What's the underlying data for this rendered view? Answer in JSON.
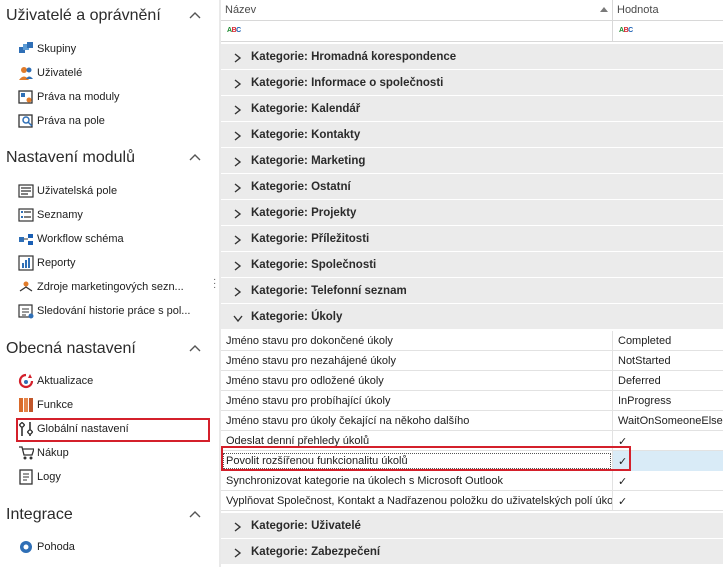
{
  "nav": {
    "sections": [
      {
        "title": "Uživatelé a oprávnění",
        "items": [
          {
            "label": "Skupiny",
            "icon": "groups-icon"
          },
          {
            "label": "Uživatelé",
            "icon": "users-icon"
          },
          {
            "label": "Práva na moduly",
            "icon": "module-rights-icon"
          },
          {
            "label": "Práva na pole",
            "icon": "field-rights-icon"
          }
        ]
      },
      {
        "title": "Nastavení modulů",
        "items": [
          {
            "label": "Uživatelská pole",
            "icon": "custom-fields-icon"
          },
          {
            "label": "Seznamy",
            "icon": "lists-icon"
          },
          {
            "label": "Workflow schéma",
            "icon": "workflow-icon"
          },
          {
            "label": "Reporty",
            "icon": "reports-icon"
          },
          {
            "label": "Zdroje marketingových sezn...",
            "icon": "marketing-sources-icon"
          },
          {
            "label": "Sledování historie práce s pol...",
            "icon": "history-tracking-icon"
          }
        ]
      },
      {
        "title": "Obecná nastavení",
        "items": [
          {
            "label": "Aktualizace",
            "icon": "update-icon"
          },
          {
            "label": "Funkce",
            "icon": "features-icon"
          },
          {
            "label": "Globální nastavení",
            "icon": "global-settings-icon",
            "selected": true
          },
          {
            "label": "Nákup",
            "icon": "cart-icon"
          },
          {
            "label": "Logy",
            "icon": "logs-icon"
          }
        ]
      },
      {
        "title": "Integrace",
        "items": [
          {
            "label": "Pohoda",
            "icon": "pohoda-icon"
          }
        ]
      }
    ]
  },
  "grid": {
    "columns": {
      "name": "Název",
      "value": "Hodnota"
    },
    "filter_icon": "abc-filter-icon",
    "colors": {
      "group_bg": "#ebebeb",
      "focus_bg": "#d9ebf7",
      "highlight": "#d4202b"
    },
    "groups_before": [
      "Kategorie: Hromadná korespondence",
      "Kategorie: Informace o společnosti",
      "Kategorie: Kalendář",
      "Kategorie: Kontakty",
      "Kategorie: Marketing",
      "Kategorie: Ostatní",
      "Kategorie: Projekty",
      "Kategorie: Příležitosti",
      "Kategorie: Společnosti",
      "Kategorie: Telefonní seznam"
    ],
    "expanded_group": "Kategorie: Úkoly",
    "rows": [
      {
        "name": "Jméno stavu pro dokončené úkoly",
        "value": "Completed"
      },
      {
        "name": "Jméno stavu pro nezahájené úkoly",
        "value": "NotStarted"
      },
      {
        "name": "Jméno stavu pro odložené úkoly",
        "value": "Deferred"
      },
      {
        "name": "Jméno stavu pro probíhající úkoly",
        "value": "InProgress"
      },
      {
        "name": "Jméno stavu pro úkoly čekající na někoho dalšího",
        "value": "WaitOnSomeoneElse"
      },
      {
        "name": "Odeslat denní přehledy úkolů",
        "value": "✓"
      },
      {
        "name": "Povolit rozšířenou funkcionalitu úkolů",
        "value": "✓",
        "focused": true
      },
      {
        "name": "Synchronizovat kategorie na úkolech s Microsoft Outlook",
        "value": "✓"
      },
      {
        "name": "Vyplňovat Společnost, Kontakt a Nadřazenou položku do uživatelských polí úko...",
        "value": "✓"
      }
    ],
    "groups_after": [
      "Kategorie: Uživatelé",
      "Kategorie: Zabezpečení"
    ]
  }
}
